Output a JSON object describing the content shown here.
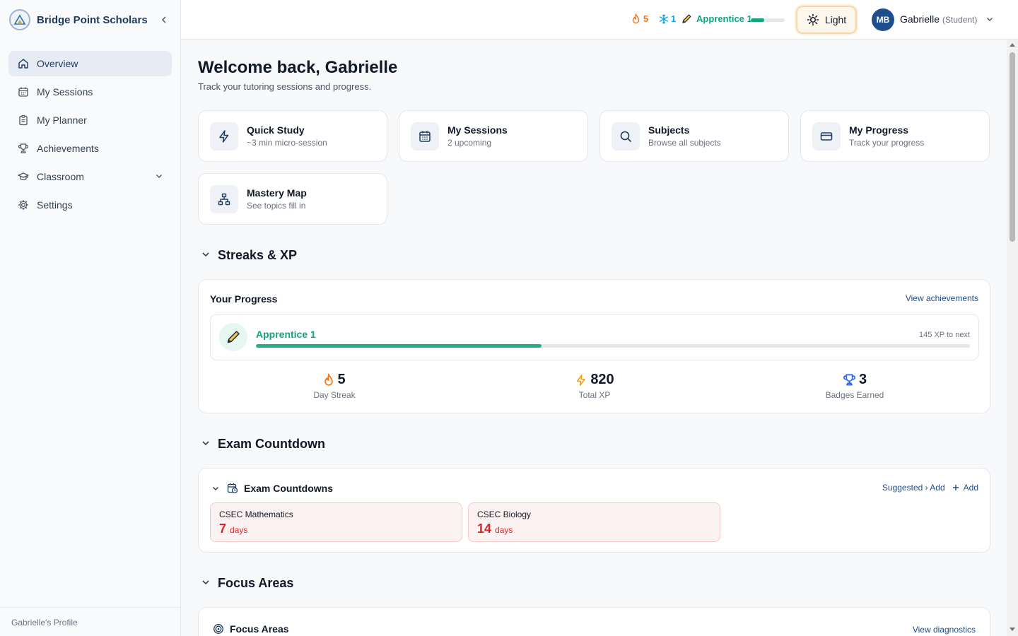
{
  "brand": {
    "name": "Bridge Point Scholars"
  },
  "sidebar": {
    "items": [
      {
        "label": "Overview",
        "icon": "home-icon"
      },
      {
        "label": "My Sessions",
        "icon": "calendar-icon"
      },
      {
        "label": "My Planner",
        "icon": "clipboard-icon"
      },
      {
        "label": "Achievements",
        "icon": "trophy-icon"
      },
      {
        "label": "Classroom",
        "icon": "graduation-cap-icon"
      },
      {
        "label": "Settings",
        "icon": "gear-icon"
      }
    ],
    "footer": "Gabrielle's Profile"
  },
  "topbar": {
    "streak": "5",
    "freeze": "1",
    "level": "Apprentice 1",
    "level_progress": 0.4,
    "theme_label": "Light",
    "avatar_initials": "MB",
    "user_name": "Gabrielle",
    "user_role": "(Student)"
  },
  "page": {
    "title": "Welcome back, Gabrielle",
    "subtitle": "Track your tutoring sessions and progress."
  },
  "quick_links": [
    {
      "title": "Quick Study",
      "sub": "~3 min micro-session",
      "icon": "lightning-icon"
    },
    {
      "title": "My Sessions",
      "sub": "2 upcoming",
      "icon": "calendar-icon"
    },
    {
      "title": "Subjects",
      "sub": "Browse all subjects",
      "icon": "search-icon"
    },
    {
      "title": "My Progress",
      "sub": "Track your progress",
      "icon": "card-icon"
    },
    {
      "title": "Mastery Map",
      "sub": "See topics fill in",
      "icon": "sitemap-icon"
    }
  ],
  "streaks": {
    "section_title": "Streaks & XP",
    "panel_title": "Your Progress",
    "link": "View achievements",
    "level_name": "Apprentice 1",
    "xp_to_next": "145 XP to next",
    "level_progress": 0.4,
    "stats": [
      {
        "value": "5",
        "label": "Day Streak",
        "icon": "flame-icon"
      },
      {
        "value": "820",
        "label": "Total XP",
        "icon": "lightning-icon"
      },
      {
        "value": "3",
        "label": "Badges Earned",
        "icon": "trophy-icon"
      }
    ]
  },
  "exams": {
    "section_title": "Exam Countdown",
    "panel_title": "Exam Countdowns",
    "suggested_link": "Suggested › Add",
    "add_link": "Add",
    "items": [
      {
        "name": "CSEC Mathematics",
        "days": "7",
        "unit": "days"
      },
      {
        "name": "CSEC Biology",
        "days": "14",
        "unit": "days"
      }
    ]
  },
  "focus": {
    "section_title": "Focus Areas",
    "panel_title": "Focus Areas",
    "link": "View diagnostics"
  },
  "colors": {
    "brand": "#1e3a5f",
    "accent": "#14a37f",
    "streak": "#f97316",
    "freeze": "#0ea5e9",
    "danger": "#dc2626",
    "link": "#1e4e8c"
  }
}
